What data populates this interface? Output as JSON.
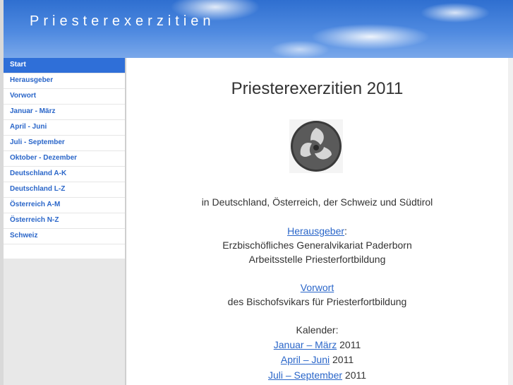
{
  "site_title": "Priesterexerzitien",
  "menu": [
    {
      "label": "Start",
      "active": true
    },
    {
      "label": "Herausgeber"
    },
    {
      "label": "Vorwort"
    },
    {
      "label": "Januar - März"
    },
    {
      "label": "April - Juni"
    },
    {
      "label": "Juli - September"
    },
    {
      "label": "Oktober - Dezember"
    },
    {
      "label": "Deutschland A-K"
    },
    {
      "label": "Deutschland L-Z"
    },
    {
      "label": "Österreich A-M"
    },
    {
      "label": "Österreich N-Z"
    },
    {
      "label": "Schweiz"
    }
  ],
  "content": {
    "title": "Priesterexerzitien 2011",
    "subtitle": "in Deutschland, Österreich, der Schweiz und Südtirol",
    "herausgeber_link": "Herausgeber",
    "herausgeber_colon": ":",
    "herausgeber_line1": "Erzbischöfliches Generalvikariat Paderborn",
    "herausgeber_line2": "Arbeitsstelle Priesterfortbildung",
    "vorwort_link": "Vorwort",
    "vorwort_line": "des Bischofsvikars für Priesterfortbildung",
    "kalender_label": "Kalender:",
    "kalender": [
      {
        "link": "Januar – März",
        "year": " 2011"
      },
      {
        "link": "April – Juni",
        "year": " 2011"
      },
      {
        "link": "Juli – September",
        "year": " 2011"
      }
    ]
  }
}
